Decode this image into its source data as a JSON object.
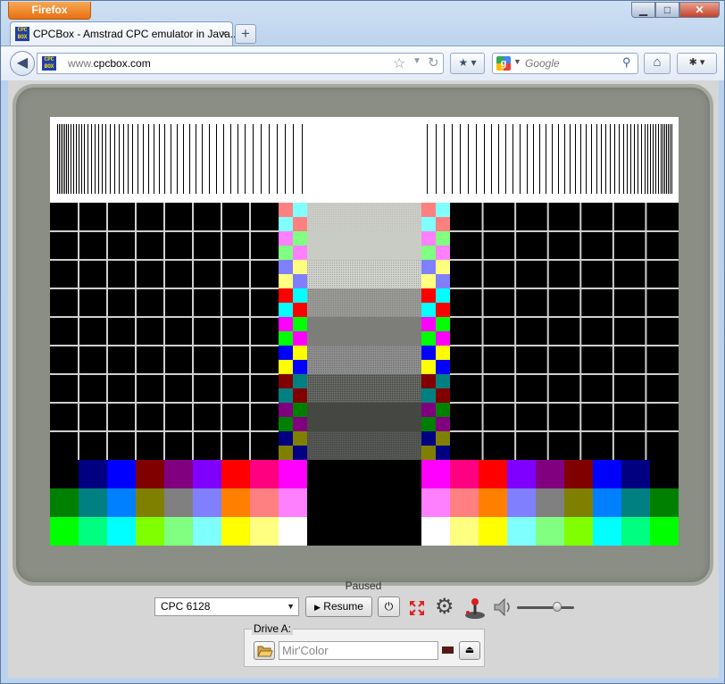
{
  "window": {
    "app_button": "Firefox",
    "minimize": "▁",
    "maximize": "□",
    "close": "✕"
  },
  "tab": {
    "favicon": "CPC BOX",
    "title": "CPCBox - Amstrad CPC emulator in Java...",
    "close": "×"
  },
  "new_tab": "+",
  "navbar": {
    "url": "www.cpcbox.com",
    "url_prefix": "www.",
    "url_host": "cpcbox.com",
    "search_placeholder": "Google"
  },
  "emulator": {
    "status": "Paused",
    "model": "CPC 6128",
    "resume_label": "Resume",
    "volume_level": 0.7,
    "drive": {
      "legend": "Drive A:",
      "disk_name": "Mir'Color"
    },
    "led_color": "#551a12"
  },
  "test_pattern": {
    "colors": {
      "black": "#000000",
      "white": "#ffffff",
      "grid_line": "#cfcfcf",
      "bar_line": "#000000"
    },
    "bottom_rows": [
      [
        "#000000",
        "#000080",
        "#0000ff",
        "#800000",
        "#800080",
        "#8000ff",
        "#ff0000",
        "#ff0080",
        "#ff00ff"
      ],
      [
        "#008000",
        "#008080",
        "#0080ff",
        "#808000",
        "#808080",
        "#8080ff",
        "#ff8000",
        "#ff8080",
        "#ff80ff"
      ],
      [
        "#00ff00",
        "#00ff80",
        "#00ffff",
        "#80ff00",
        "#80ff80",
        "#80ffff",
        "#ffff00",
        "#ffff80",
        "#ffffff"
      ]
    ],
    "checker_pairs": [
      [
        "#ff8080",
        "#80ffff"
      ],
      [
        "#80ffff",
        "#ff8080"
      ],
      [
        "#ff80ff",
        "#80ff80"
      ],
      [
        "#80ff80",
        "#ff80ff"
      ],
      [
        "#8080ff",
        "#ffff80"
      ],
      [
        "#ffff80",
        "#8080ff"
      ],
      [
        "#ff0000",
        "#00ffff"
      ],
      [
        "#00ffff",
        "#ff0000"
      ],
      [
        "#ff00ff",
        "#00ff00"
      ],
      [
        "#00ff00",
        "#ff00ff"
      ],
      [
        "#0000ff",
        "#ffff00"
      ],
      [
        "#ffff00",
        "#0000ff"
      ],
      [
        "#800000",
        "#008080"
      ],
      [
        "#008080",
        "#800000"
      ],
      [
        "#800080",
        "#008000"
      ],
      [
        "#008000",
        "#800080"
      ],
      [
        "#000080",
        "#808000"
      ],
      [
        "#808000",
        "#000080"
      ]
    ],
    "gray_bands": [
      "#c4c6bf",
      "#c8ccc4",
      "#d4d6d0",
      "#8d8e8a",
      "#7d7e7a",
      "#909190",
      "#535650",
      "#454742",
      "#565955"
    ]
  }
}
